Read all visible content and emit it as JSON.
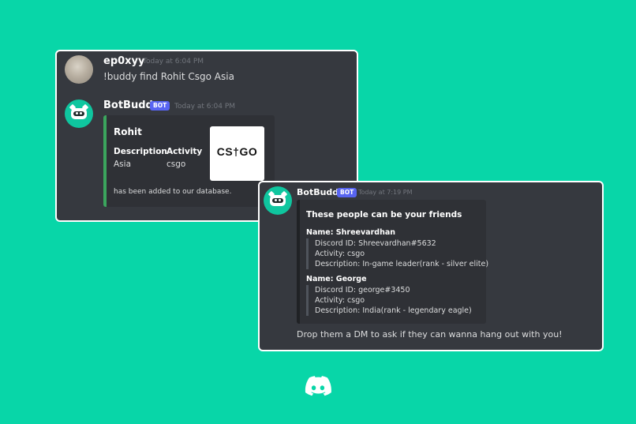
{
  "card1": {
    "msg1": {
      "username": "ep0xyy",
      "timestamp": "Today at 6:04 PM",
      "text": "!buddy find Rohit Csgo Asia"
    },
    "msg2": {
      "username": "BotBuddy",
      "tag": "BOT",
      "timestamp": "Today at 6:04 PM",
      "embed": {
        "title": "Rohit",
        "fields": [
          {
            "name": "Description",
            "value": "Asia"
          },
          {
            "name": "Activity",
            "value": "csgo"
          }
        ],
        "thumbnail_text": "CS†GO",
        "footer": "has been added to our database.",
        "accent": "#3ba55d"
      }
    }
  },
  "card2": {
    "username": "BotBuddy",
    "tag": "BOT",
    "timestamp": "Today at 7:19 PM",
    "embed": {
      "title": "These people can be your friends",
      "people": [
        {
          "name_line": "Name: Shreevardhan",
          "lines": [
            "Discord ID: Shreevardhan#5632",
            "Activity: csgo",
            "Description: In-game leader(rank - silver elite)"
          ]
        },
        {
          "name_line": "Name: George",
          "lines": [
            "Discord ID: george#3450",
            "Activity: csgo",
            "Description: India(rank - legendary eagle)"
          ]
        }
      ],
      "accent": "#202225"
    },
    "text": "Drop them a DM to ask if they can wanna hang out with you!"
  },
  "colors": {
    "background": "#08d6a8",
    "card": "#36393f",
    "embed": "#2f3136",
    "bot_tag": "#5865f2"
  },
  "icons": {
    "footer_logo": "discord-logo-icon"
  }
}
